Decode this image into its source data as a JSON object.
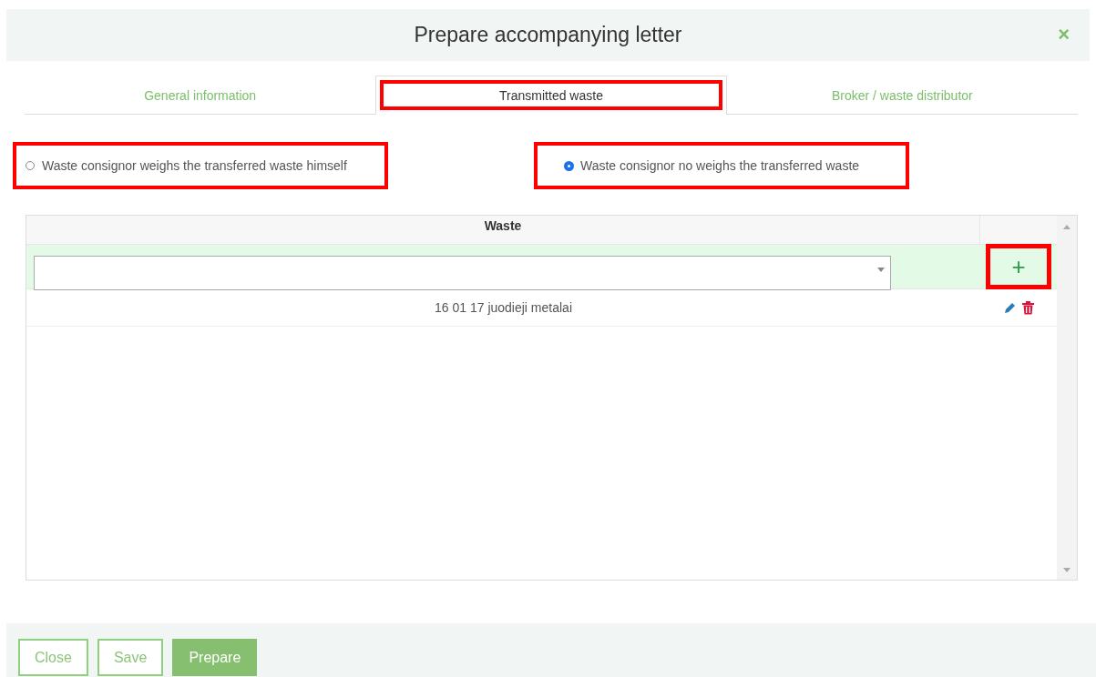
{
  "dialog": {
    "title": "Prepare accompanying letter",
    "close": "×"
  },
  "tabs": [
    {
      "label": "General information",
      "selected": false,
      "highlighted": false
    },
    {
      "label": "Transmitted waste",
      "selected": true,
      "highlighted": true
    },
    {
      "label": "Broker / waste distributor",
      "selected": false,
      "highlighted": false
    }
  ],
  "options": [
    {
      "label": "Waste consignor weighs the transferred waste himself",
      "selected": false,
      "highlighted": true
    },
    {
      "label": "Waste consignor no weighs the transferred waste",
      "selected": true,
      "highlighted": true
    }
  ],
  "table": {
    "columns": [
      "Waste"
    ],
    "add_button": {
      "label": "+",
      "highlighted": true
    },
    "rows": [
      {
        "waste": "16 01 17 juodieji metalai"
      }
    ]
  },
  "buttons": [
    {
      "label": "Close",
      "kind": "secondary"
    },
    {
      "label": "Save",
      "kind": "secondary"
    },
    {
      "label": "Prepare",
      "kind": "primary"
    }
  ]
}
